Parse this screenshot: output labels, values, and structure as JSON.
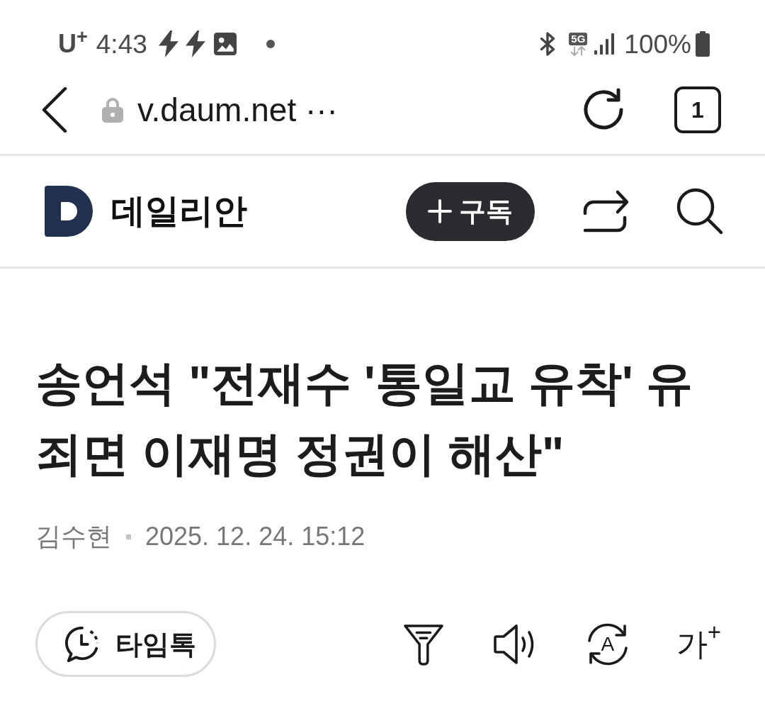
{
  "status_bar": {
    "carrier": "U$^{+}$",
    "time": "4:43",
    "network": "5G",
    "battery": "100%"
  },
  "browser_bar": {
    "url": "v.daum.net ···",
    "tab_count": "1"
  },
  "site_header": {
    "name": "데일리안",
    "subscribe_label": "구독"
  },
  "article": {
    "headline": "송언석 \"전재수 '통일교 유착' 유죄면 이재명 정권이 해산\"",
    "author": "김수현",
    "date": "2025. 12. 24. 15:12"
  },
  "toolbar": {
    "timetalk_label": "타임톡",
    "actions": [
      {
        "kind": "filter"
      },
      {
        "kind": "speaker"
      },
      {
        "kind": "translate",
        "glyph": "A"
      },
      {
        "kind": "font_size",
        "glyph": "가$^{+}$"
      }
    ]
  }
}
